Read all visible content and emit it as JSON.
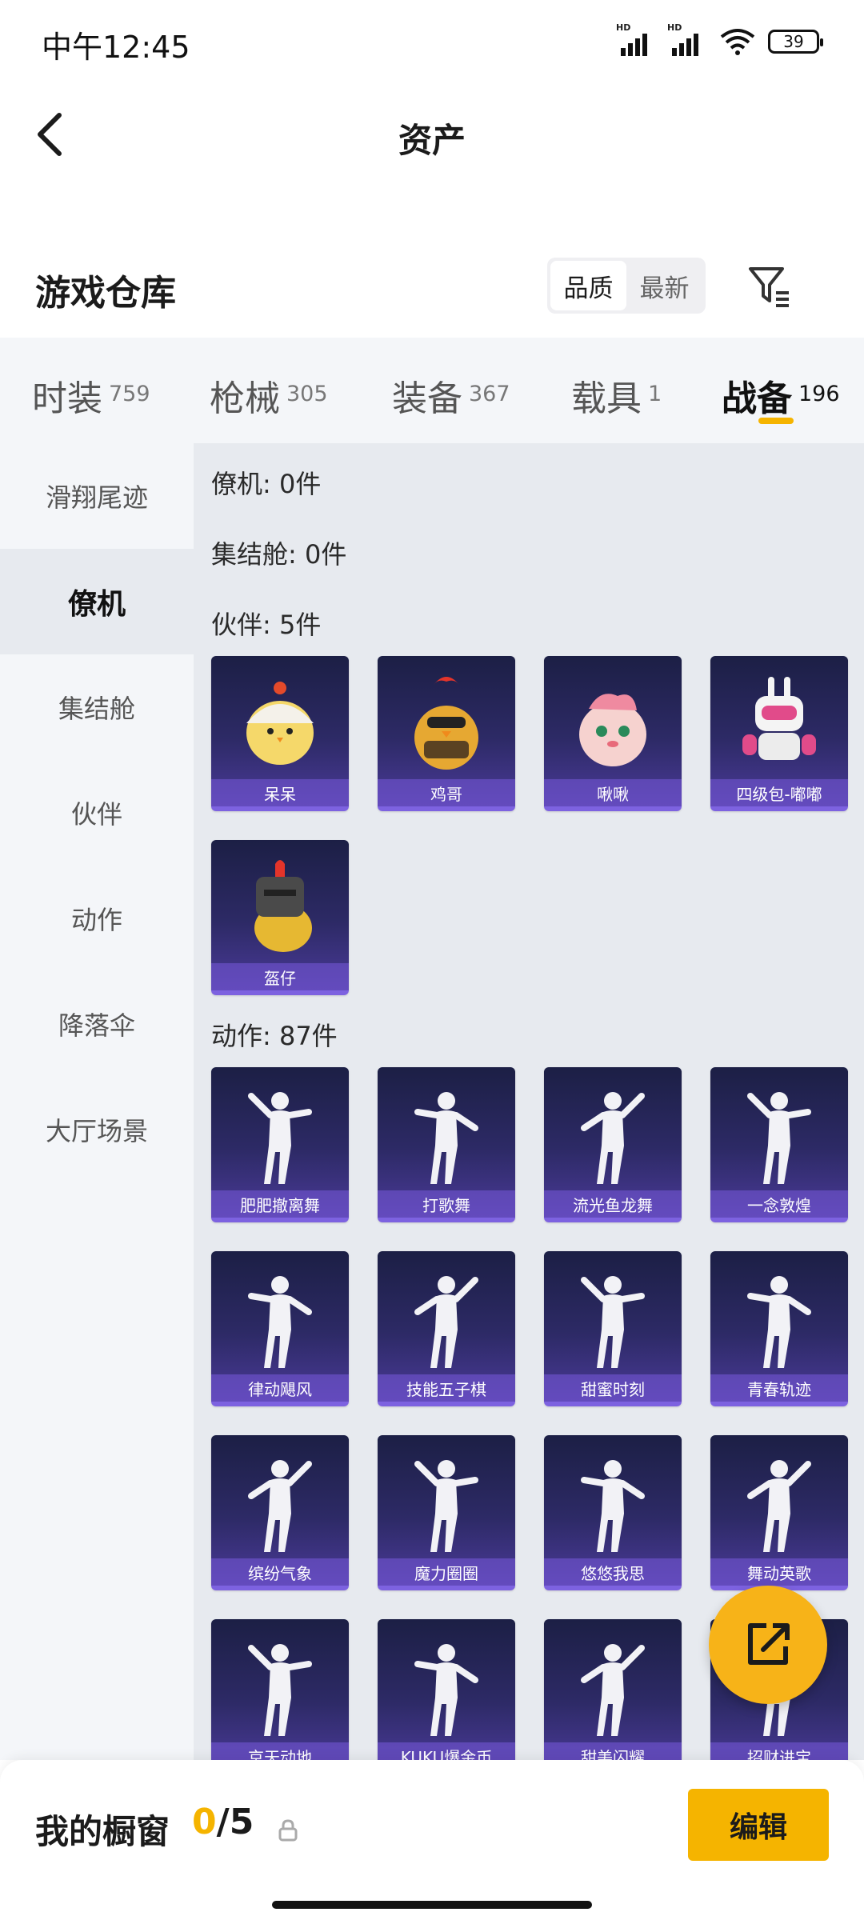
{
  "status_bar": {
    "time": "中午12:45",
    "battery": "39",
    "hd": "HD"
  },
  "header": {
    "title": "资产"
  },
  "warehouse": {
    "title": "游戏仓库",
    "sort_options": [
      "品质",
      "最新"
    ],
    "active_sort": "品质"
  },
  "category_tabs": [
    {
      "label": "时装",
      "count": "759"
    },
    {
      "label": "枪械",
      "count": "305"
    },
    {
      "label": "装备",
      "count": "367"
    },
    {
      "label": "载具",
      "count": "1"
    },
    {
      "label": "战备",
      "count": "196"
    }
  ],
  "sidebar": {
    "items": [
      "滑翔尾迹",
      "僚机",
      "集结舱",
      "伙伴",
      "动作",
      "降落伞",
      "大厅场景"
    ],
    "active": "僚机"
  },
  "sections": {
    "wingman": "僚机: 0件",
    "rally_pod": "集结舱: 0件",
    "partner": "伙伴: 5件",
    "emote": "动作: 87件"
  },
  "partner_items": [
    "呆呆",
    "鸡哥",
    "啾啾",
    "四级包-嘟嘟",
    "盔仔"
  ],
  "emote_items": [
    "肥肥撤离舞",
    "打歌舞",
    "流光鱼龙舞",
    "一念敦煌",
    "律动飓风",
    "技能五子棋",
    "甜蜜时刻",
    "青春轨迹",
    "缤纷气象",
    "魔力圈圈",
    "悠悠我思",
    "舞动英歌",
    "京天动地",
    "KUKU爆金币",
    "甜美闪耀",
    "招财进宝"
  ],
  "bottom_bar": {
    "label": "我的橱窗",
    "current": "0",
    "total": "/5",
    "edit": "编辑"
  },
  "colors": {
    "accent": "#f5b400",
    "card_bg": "#2d2a66",
    "card_bar": "#7d62e0"
  }
}
